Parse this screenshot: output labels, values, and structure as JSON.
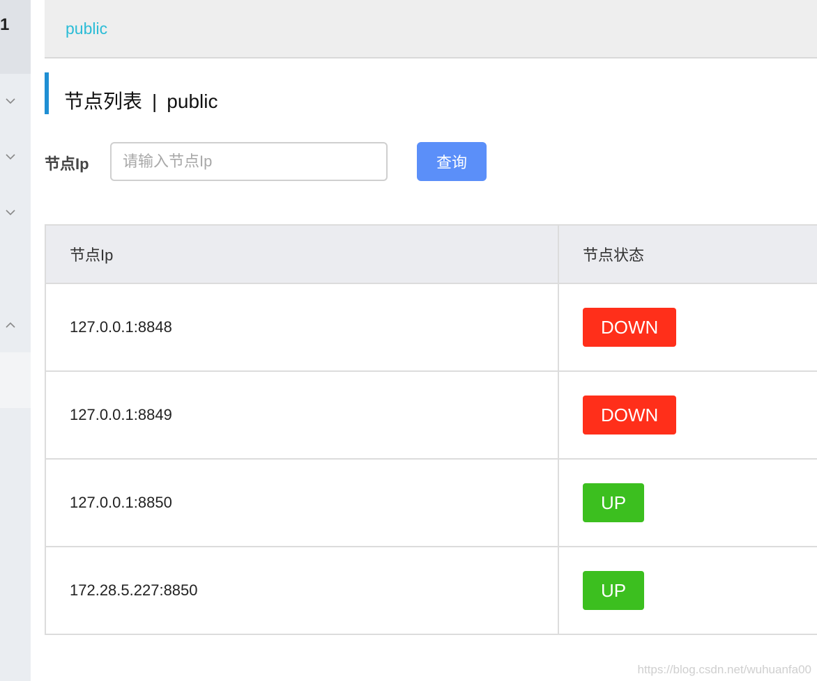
{
  "sidebar": {
    "number": "1",
    "chevrons": [
      "chevron-down-icon",
      "chevron-down-icon",
      "chevron-down-icon",
      "chevron-up-icon"
    ]
  },
  "topbar": {
    "namespace": "public"
  },
  "title": {
    "main": "节点列表",
    "separator": "|",
    "namespace": "public"
  },
  "search": {
    "label": "节点Ip",
    "placeholder": "请输入节点Ip",
    "value": "",
    "button": "查询"
  },
  "table": {
    "headers": [
      "节点Ip",
      "节点状态"
    ],
    "rows": [
      {
        "ip": "127.0.0.1:8848",
        "status": "DOWN"
      },
      {
        "ip": "127.0.0.1:8849",
        "status": "DOWN"
      },
      {
        "ip": "127.0.0.1:8850",
        "status": "UP"
      },
      {
        "ip": "172.28.5.227:8850",
        "status": "UP"
      }
    ]
  },
  "colors": {
    "accent": "#5b8ff9",
    "namespace": "#2bbcd6",
    "title_bar": "#1f8fd3",
    "down": "#ff2f1a",
    "up": "#3cbf1f"
  },
  "watermark": "https://blog.csdn.net/wuhuanfa00"
}
